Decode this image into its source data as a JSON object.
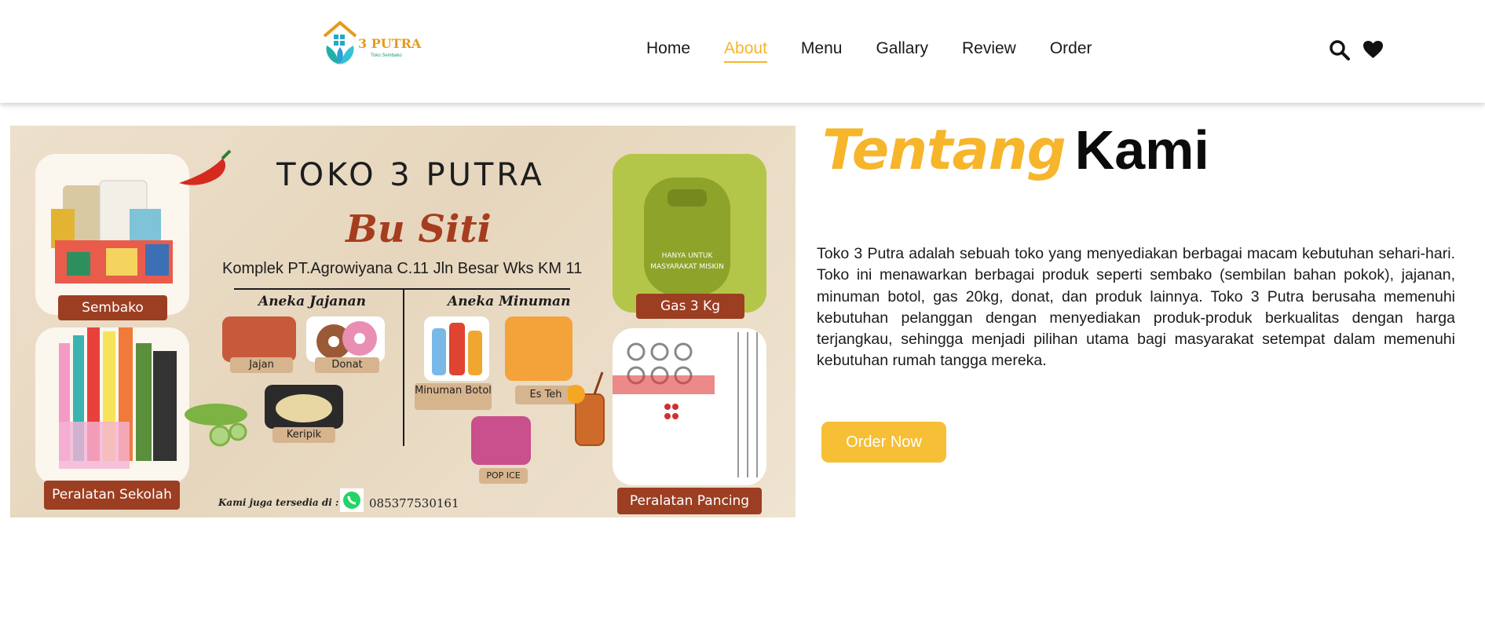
{
  "header": {
    "logo_text": "3 PUTRA",
    "logo_sub": "Toko Sembako",
    "nav": [
      {
        "label": "Home"
      },
      {
        "label": "About"
      },
      {
        "label": "Menu"
      },
      {
        "label": "Gallary"
      },
      {
        "label": "Review"
      },
      {
        "label": "Order"
      }
    ],
    "icons": [
      "search-icon",
      "heart-icon"
    ]
  },
  "banner": {
    "title": "TOKO 3 PUTRA",
    "subtitle": "Bu Siti",
    "address": "Komplek PT.Agrowiyana C.11 Jln Besar Wks KM 11",
    "categories": {
      "sembako": "Sembako",
      "peralatan_sekolah": "Peralatan Sekolah",
      "gas": "Gas 3 Kg",
      "peralatan_pancing": "Peralatan Pancing"
    },
    "jajanan_head": "Aneka Jajanan",
    "minuman_head": "Aneka Minuman",
    "items": {
      "jajan": "Jajan",
      "donat": "Donat",
      "keripik": "Keripik",
      "minuman_botol": "Minuman Botol",
      "es_teh": "Es Teh",
      "pop_ice": "POP ICE"
    },
    "footer_note": "Kami juga tersedia di :",
    "phone": "085377530161"
  },
  "about": {
    "heading_accent": "Tentang",
    "heading_main": "Kami",
    "paragraph": "Toko 3 Putra adalah sebuah toko yang menyediakan berbagai macam kebutuhan sehari-hari. Toko ini menawarkan berbagai produk seperti sembako (sembilan bahan pokok), jajanan, minuman botol, gas 20kg, donat, dan produk lainnya. Toko 3 Putra berusaha memenuhi kebutuhan pelanggan dengan menyediakan produk-produk berkualitas dengan harga terjangkau, sehingga menjadi pilihan utama bagi masyarakat setempat dalam memenuhi kebutuhan rumah tangga mereka.",
    "button": "Order Now"
  },
  "colors": {
    "accent": "#f6b52b",
    "button": "#f6bf35",
    "label_brown": "#9c3e22"
  }
}
